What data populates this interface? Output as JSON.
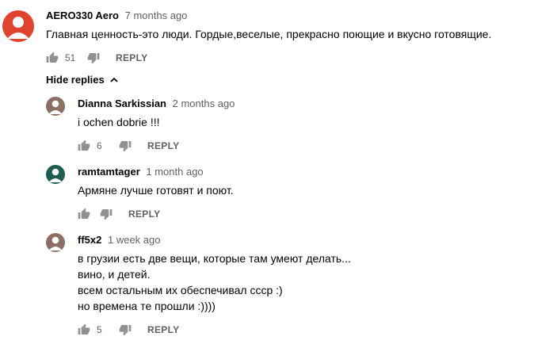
{
  "top_comment": {
    "author": "AERO330 Aero",
    "time": "7 months ago",
    "text": "Главная ценность-это люди. Гордые,веселые, прекрасно поющие и вкусно готовящие.",
    "likes": "51",
    "reply_label": "REPLY",
    "avatar_color": "#e0442e"
  },
  "toggle_replies_label": "Hide replies",
  "replies": [
    {
      "author": "Dianna Sarkissian",
      "time": "2 months ago",
      "lines": [
        "i  ochen dobrie !!!"
      ],
      "likes": "6",
      "reply_label": "REPLY",
      "avatar_color": "#8d6e63"
    },
    {
      "author": "ramtamtager",
      "time": "1 month ago",
      "lines": [
        "Армяне лучше готовят и поют."
      ],
      "likes": "",
      "reply_label": "REPLY",
      "avatar_color": "#1e5e52"
    },
    {
      "author": "ff5x2",
      "time": "1 week ago",
      "lines": [
        "в грузии есть две вещи, которые там умеют делать...",
        "вино, и детей.",
        "всем остальным их обеспечивал ссср :)",
        "но времена те прошли :))))"
      ],
      "likes": "5",
      "reply_label": "REPLY",
      "avatar_color": "#8d6e63"
    }
  ],
  "colors": {
    "text": "#030303",
    "secondary": "#606060"
  }
}
